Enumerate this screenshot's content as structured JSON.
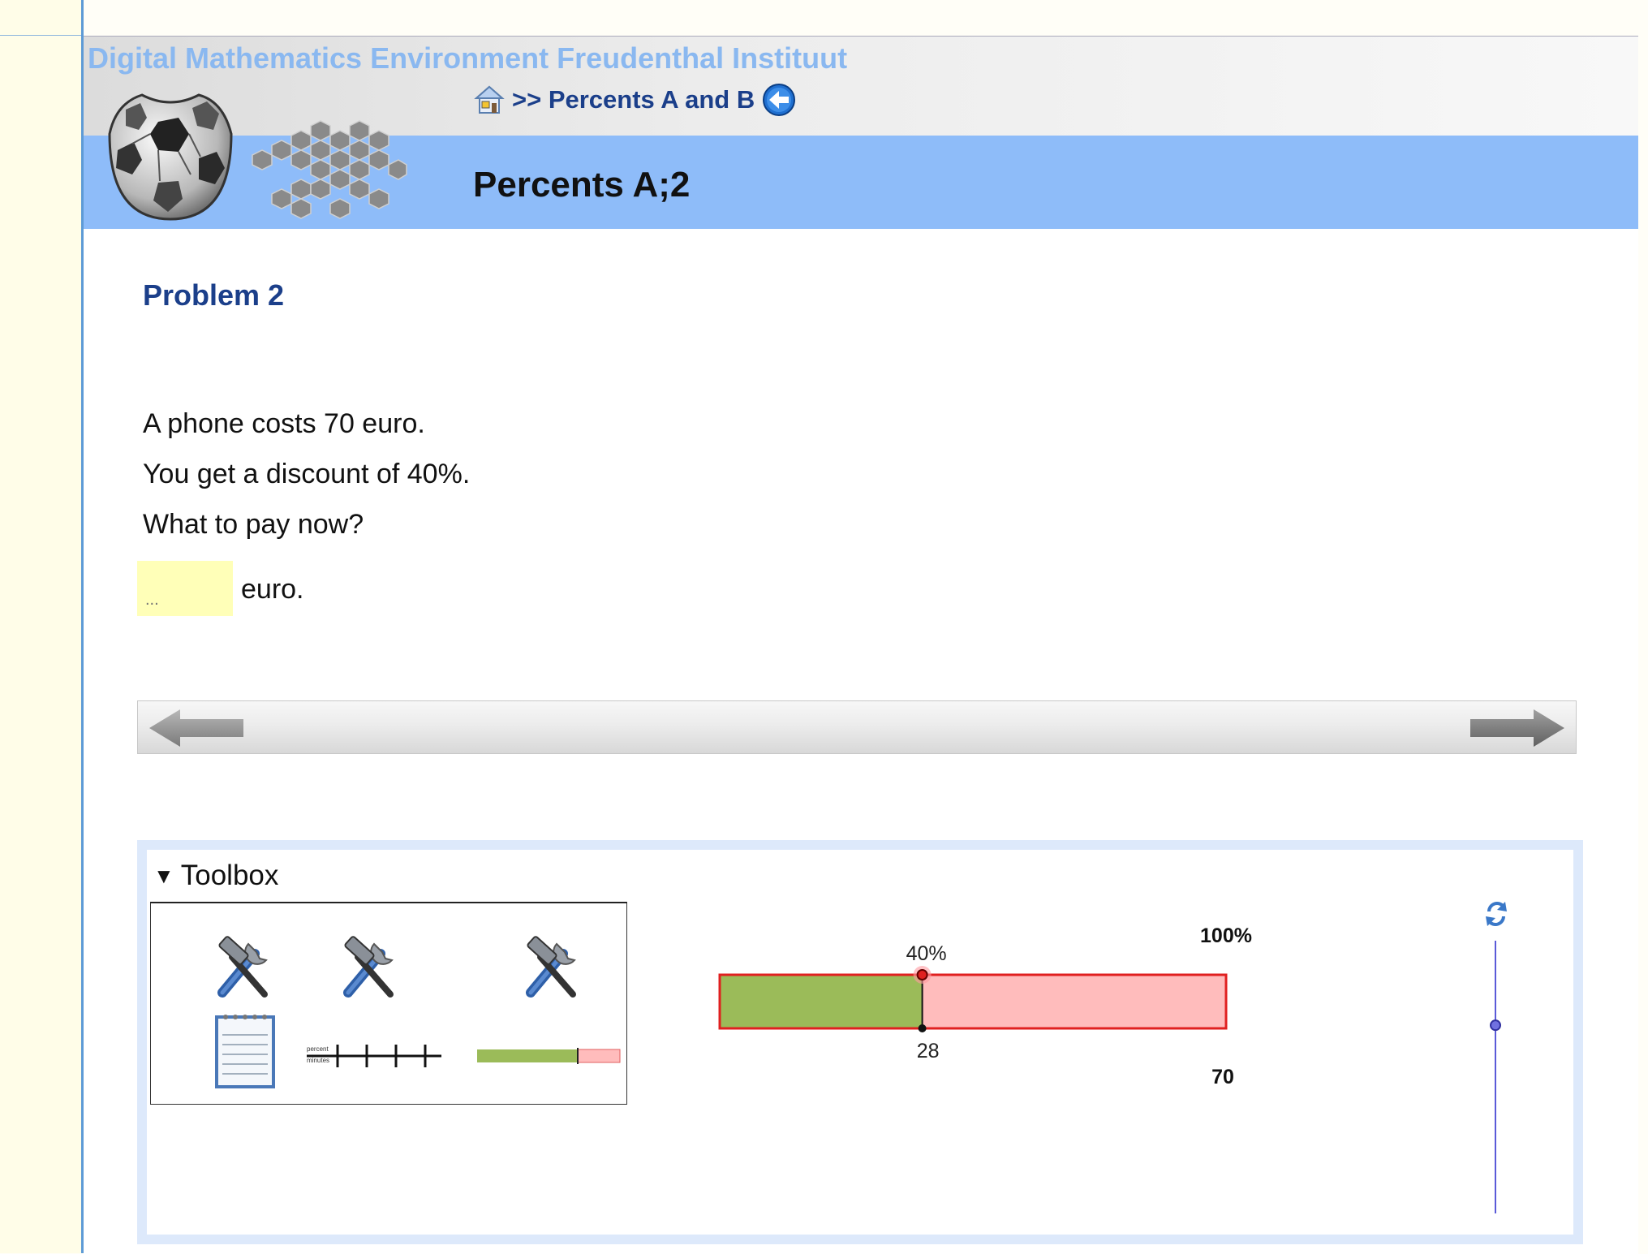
{
  "header": {
    "env_title": "Digital Mathematics Environment  Freudenthal Instituut",
    "breadcrumb": ">> Percents A and B",
    "page_title": "Percents A;2"
  },
  "problem": {
    "heading": "Problem 2",
    "lines": [
      "A phone costs 70 euro.",
      "You get a discount of 40%.",
      "What to pay now?"
    ],
    "answer_placeholder": "...",
    "answer_unit": "euro."
  },
  "toolbox": {
    "label": "Toolbox",
    "tools": [
      "notepad-tool",
      "number-line-tool",
      "percent-bar-tool"
    ],
    "numberline_labels": [
      "percent",
      "minutes"
    ]
  },
  "percent_bar": {
    "percent": 40,
    "percent_label": "40%",
    "value_label": "28",
    "total_percent_label": "100%",
    "total_value_label": "70",
    "slider_position": 0.31
  },
  "colors": {
    "accent_blue": "#8ebcf9",
    "title_blue": "#1b3f8a",
    "answer_bg": "#ffffb8",
    "bar_green": "#9bbb59",
    "bar_pink": "#ffbcbc",
    "bar_outline": "#e02020"
  }
}
